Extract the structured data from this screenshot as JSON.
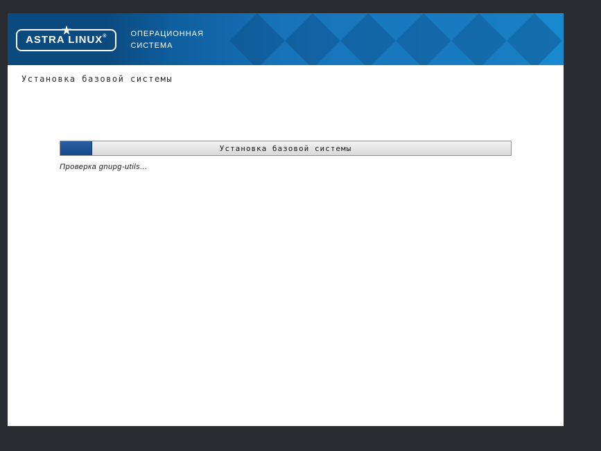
{
  "header": {
    "brand": "ASTRA LINUX",
    "tagline_line1": "ОПЕРАЦИОННАЯ",
    "tagline_line2": "СИСТЕМА"
  },
  "page": {
    "title": "Установка базовой системы"
  },
  "progress": {
    "label": "Установка базовой системы",
    "percent": 7,
    "status": "Проверка gnupg-utils..."
  }
}
